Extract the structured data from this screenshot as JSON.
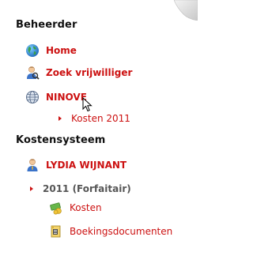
{
  "beheerder": {
    "title": "Beheerder",
    "items": [
      {
        "label": "Home",
        "icon": "globe-icon"
      },
      {
        "label": "Zoek vrijwilliger",
        "icon": "user-search-icon"
      },
      {
        "label": "NINOVE",
        "icon": "web-globe-icon"
      }
    ],
    "sub_item": {
      "label": "Kosten 2011"
    }
  },
  "kostensysteem": {
    "title": "Kostensysteem",
    "user": {
      "label": "LYDIA WIJNANT",
      "icon": "user-icon"
    },
    "year": {
      "label": "2011 (Forfaitair)"
    },
    "items": [
      {
        "label": "Kosten",
        "icon": "money-icon"
      },
      {
        "label": "Boekingsdocumenten",
        "icon": "document-icon"
      }
    ]
  },
  "colors": {
    "link": "#cc1111",
    "heading": "#111111",
    "year_text": "#555555"
  }
}
